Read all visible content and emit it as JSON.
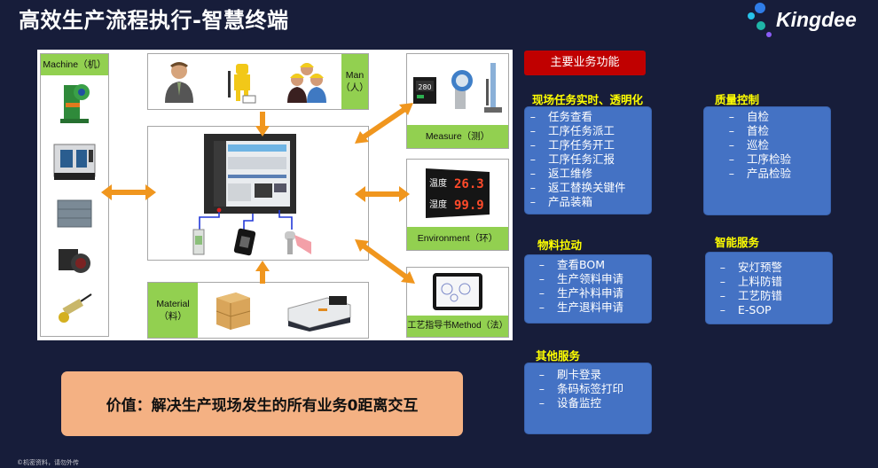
{
  "header": {
    "title": "高效生产流程执行-智慧终端",
    "brand": "Kingdee"
  },
  "diagram": {
    "machine": {
      "label": "Machine（机）",
      "icons": [
        "press-machine-icon",
        "cnc-machine-icon",
        "plc-module-icon",
        "industrial-camera-icon",
        "proximity-sensor-icon"
      ]
    },
    "man": {
      "label_line1": "Man",
      "label_line2": "（人）",
      "icons": [
        "manager-icon",
        "worker-robot-icon",
        "team-workers-icon"
      ]
    },
    "center": {
      "icons": [
        "touch-terminal-icon",
        "io-module-icon",
        "rfid-reader-icon",
        "barcode-scanner-icon"
      ]
    },
    "material": {
      "label_line1": "Material",
      "label_line2": "（料）",
      "icons": [
        "cargo-pallet-icon",
        "agv-robot-icon"
      ]
    },
    "measure": {
      "label": "Measure（测）",
      "icons": [
        "temperature-controller-icon",
        "pressure-transmitter-icon",
        "level-gauge-icon"
      ]
    },
    "environment": {
      "label": "Environment（环）",
      "display_temp": "26.3",
      "display_humidity": "99.9",
      "display_temp_label": "温度",
      "display_humidity_label": "湿度"
    },
    "method": {
      "label": "工艺指导书Method（法）"
    }
  },
  "panel": {
    "main_button": "主要业务功能",
    "sections": [
      {
        "title": "现场任务实时、透明化",
        "items": [
          "任务查看",
          "工序任务派工",
          "工序任务开工",
          "工序任务汇报",
          "返工维修",
          "返工替换关键件",
          "产品装箱"
        ]
      },
      {
        "title": "质量控制",
        "items": [
          "自检",
          "首检",
          "巡检",
          "工序检验",
          "产品检验"
        ]
      },
      {
        "title": "物料拉动",
        "items": [
          "查看BOM",
          "生产领料申请",
          "生产补料申请",
          "生产退料申请"
        ]
      },
      {
        "title": "智能服务",
        "items": [
          "安灯预警",
          "上料防错",
          "工艺防错",
          "E-SOP"
        ]
      },
      {
        "title": "其他服务",
        "items": [
          "刷卡登录",
          "条码标签打印",
          "设备监控"
        ]
      }
    ],
    "dash": "–"
  },
  "value": {
    "text": "价值：解决生产现场发生的所有业务0距离交互"
  },
  "footer": {
    "text": "©机密资料，请勿外传"
  },
  "colors": {
    "background": "#171d3a",
    "label_green": "#92d050",
    "arrow_orange": "#f0961e",
    "section_blue": "#4472c4",
    "main_button_red": "#c00000",
    "section_title_yellow": "#ffff00",
    "value_box": "#f4b183"
  }
}
